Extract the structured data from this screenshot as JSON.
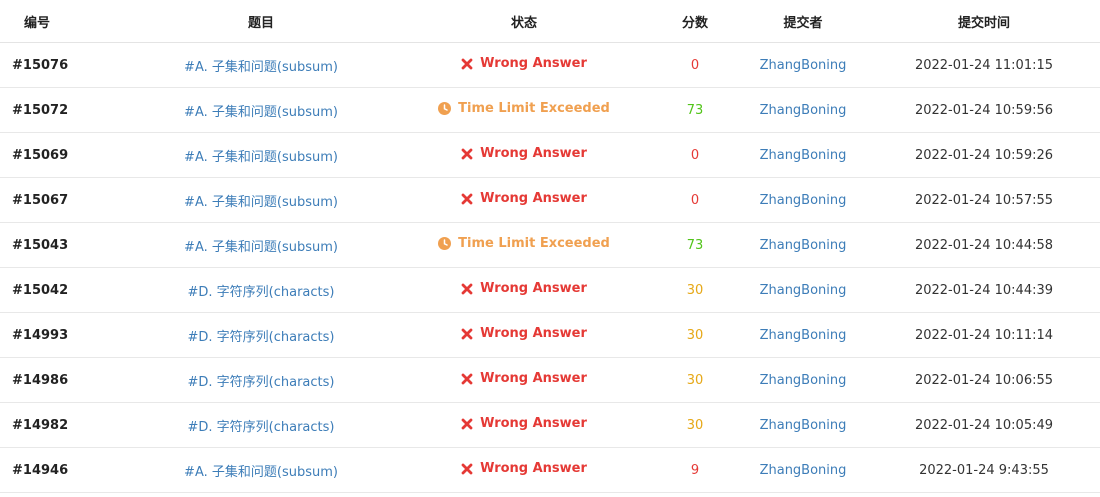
{
  "headers": {
    "id": "编号",
    "problem": "题目",
    "status": "状态",
    "score": "分数",
    "submitter": "提交者",
    "time": "提交时间"
  },
  "status_styles": {
    "Wrong Answer": {
      "color": "#e53935",
      "icon": "cross-icon"
    },
    "Time Limit Exceeded": {
      "color": "#f0a050",
      "icon": "clock-icon"
    }
  },
  "rows": [
    {
      "id": "#15076",
      "problem": "#A. 子集和问题(subsum)",
      "status": "Wrong Answer",
      "score": "0",
      "score_color": "#e53935",
      "submitter": "ZhangBoning",
      "time": "2022-01-24 11:01:15"
    },
    {
      "id": "#15072",
      "problem": "#A. 子集和问题(subsum)",
      "status": "Time Limit Exceeded",
      "score": "73",
      "score_color": "#52c41a",
      "submitter": "ZhangBoning",
      "time": "2022-01-24 10:59:56"
    },
    {
      "id": "#15069",
      "problem": "#A. 子集和问题(subsum)",
      "status": "Wrong Answer",
      "score": "0",
      "score_color": "#e53935",
      "submitter": "ZhangBoning",
      "time": "2022-01-24 10:59:26"
    },
    {
      "id": "#15067",
      "problem": "#A. 子集和问题(subsum)",
      "status": "Wrong Answer",
      "score": "0",
      "score_color": "#e53935",
      "submitter": "ZhangBoning",
      "time": "2022-01-24 10:57:55"
    },
    {
      "id": "#15043",
      "problem": "#A. 子集和问题(subsum)",
      "status": "Time Limit Exceeded",
      "score": "73",
      "score_color": "#52c41a",
      "submitter": "ZhangBoning",
      "time": "2022-01-24 10:44:58"
    },
    {
      "id": "#15042",
      "problem": "#D. 字符序列(characts)",
      "status": "Wrong Answer",
      "score": "30",
      "score_color": "#e6a817",
      "submitter": "ZhangBoning",
      "time": "2022-01-24 10:44:39"
    },
    {
      "id": "#14993",
      "problem": "#D. 字符序列(characts)",
      "status": "Wrong Answer",
      "score": "30",
      "score_color": "#e6a817",
      "submitter": "ZhangBoning",
      "time": "2022-01-24 10:11:14"
    },
    {
      "id": "#14986",
      "problem": "#D. 字符序列(characts)",
      "status": "Wrong Answer",
      "score": "30",
      "score_color": "#e6a817",
      "submitter": "ZhangBoning",
      "time": "2022-01-24 10:06:55"
    },
    {
      "id": "#14982",
      "problem": "#D. 字符序列(characts)",
      "status": "Wrong Answer",
      "score": "30",
      "score_color": "#e6a817",
      "submitter": "ZhangBoning",
      "time": "2022-01-24 10:05:49"
    },
    {
      "id": "#14946",
      "problem": "#A. 子集和问题(subsum)",
      "status": "Wrong Answer",
      "score": "9",
      "score_color": "#e53935",
      "submitter": "ZhangBoning",
      "time": "2022-01-24 9:43:55"
    }
  ]
}
